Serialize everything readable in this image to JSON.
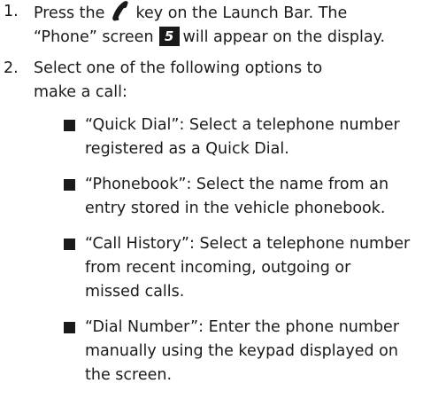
{
  "steps": [
    {
      "number": "1.",
      "line1_before": "Press the",
      "icon": "phone-handset-icon",
      "line1_after": "key on the Launch Bar. The",
      "line2_before": "“Phone” screen",
      "badge": "5",
      "line2_after": "will appear on the display."
    },
    {
      "number": "2.",
      "lines": [
        "Select one of the following options to",
        "make a call:"
      ]
    }
  ],
  "options": [
    {
      "lines": [
        "“Quick Dial”: Select a telephone number",
        "registered as a Quick Dial."
      ]
    },
    {
      "lines": [
        "“Phonebook”: Select the name from an",
        "entry stored in the vehicle phonebook."
      ]
    },
    {
      "lines": [
        "“Call History”: Select a telephone number",
        "from recent incoming, outgoing or",
        "missed calls."
      ]
    },
    {
      "lines": [
        "“Dial Number”: Enter the phone number",
        "manually using the keypad displayed on",
        "the screen."
      ]
    }
  ]
}
